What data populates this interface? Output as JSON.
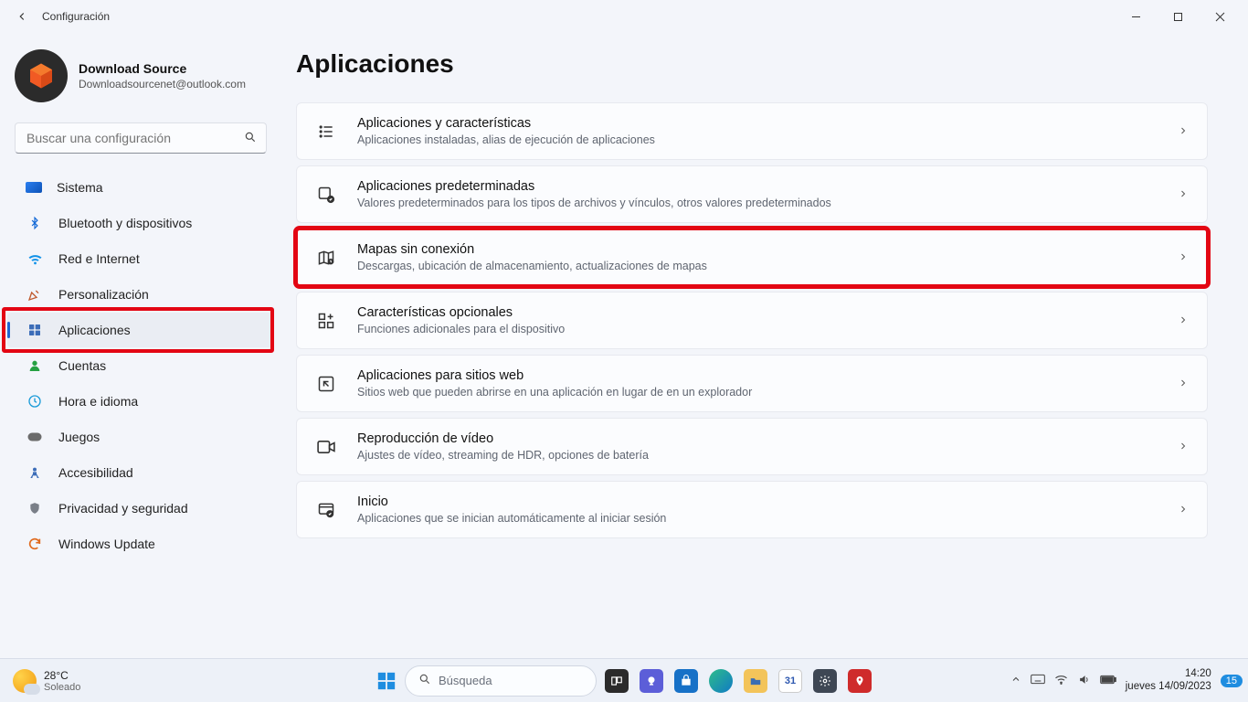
{
  "titlebar": {
    "title": "Configuración"
  },
  "account": {
    "name": "Download Source",
    "email": "Downloadsourcenet@outlook.com"
  },
  "search": {
    "placeholder": "Buscar una configuración"
  },
  "nav": [
    {
      "label": "Sistema",
      "icon": "system"
    },
    {
      "label": "Bluetooth y dispositivos",
      "icon": "bt"
    },
    {
      "label": "Red e Internet",
      "icon": "net"
    },
    {
      "label": "Personalización",
      "icon": "pers"
    },
    {
      "label": "Aplicaciones",
      "icon": "apps",
      "active": true,
      "highlight": true
    },
    {
      "label": "Cuentas",
      "icon": "acc"
    },
    {
      "label": "Hora e idioma",
      "icon": "time"
    },
    {
      "label": "Juegos",
      "icon": "game"
    },
    {
      "label": "Accesibilidad",
      "icon": "accs"
    },
    {
      "label": "Privacidad y seguridad",
      "icon": "priv"
    },
    {
      "label": "Windows Update",
      "icon": "upd"
    }
  ],
  "page": {
    "title": "Aplicaciones"
  },
  "cards": [
    {
      "title": "Aplicaciones y características",
      "desc": "Aplicaciones instaladas, alias de ejecución de aplicaciones",
      "icon": "list"
    },
    {
      "title": "Aplicaciones predeterminadas",
      "desc": "Valores predeterminados para los tipos de archivos y vínculos, otros valores predeterminados",
      "icon": "default"
    },
    {
      "title": "Mapas sin conexión",
      "desc": "Descargas, ubicación de almacenamiento, actualizaciones de mapas",
      "icon": "map",
      "highlight": true
    },
    {
      "title": "Características opcionales",
      "desc": "Funciones adicionales para el dispositivo",
      "icon": "feat"
    },
    {
      "title": "Aplicaciones para sitios web",
      "desc": "Sitios web que pueden abrirse en una aplicación en lugar de en un explorador",
      "icon": "web"
    },
    {
      "title": "Reproducción de vídeo",
      "desc": "Ajustes de vídeo, streaming de HDR, opciones de batería",
      "icon": "video"
    },
    {
      "title": "Inicio",
      "desc": "Aplicaciones que se inician automáticamente al iniciar sesión",
      "icon": "startup"
    }
  ],
  "taskbar": {
    "weather": {
      "temp": "28°C",
      "desc": "Soleado"
    },
    "search": "Búsqueda",
    "time": "14:20",
    "date": "jueves 14/09/2023",
    "notifications": "15"
  }
}
